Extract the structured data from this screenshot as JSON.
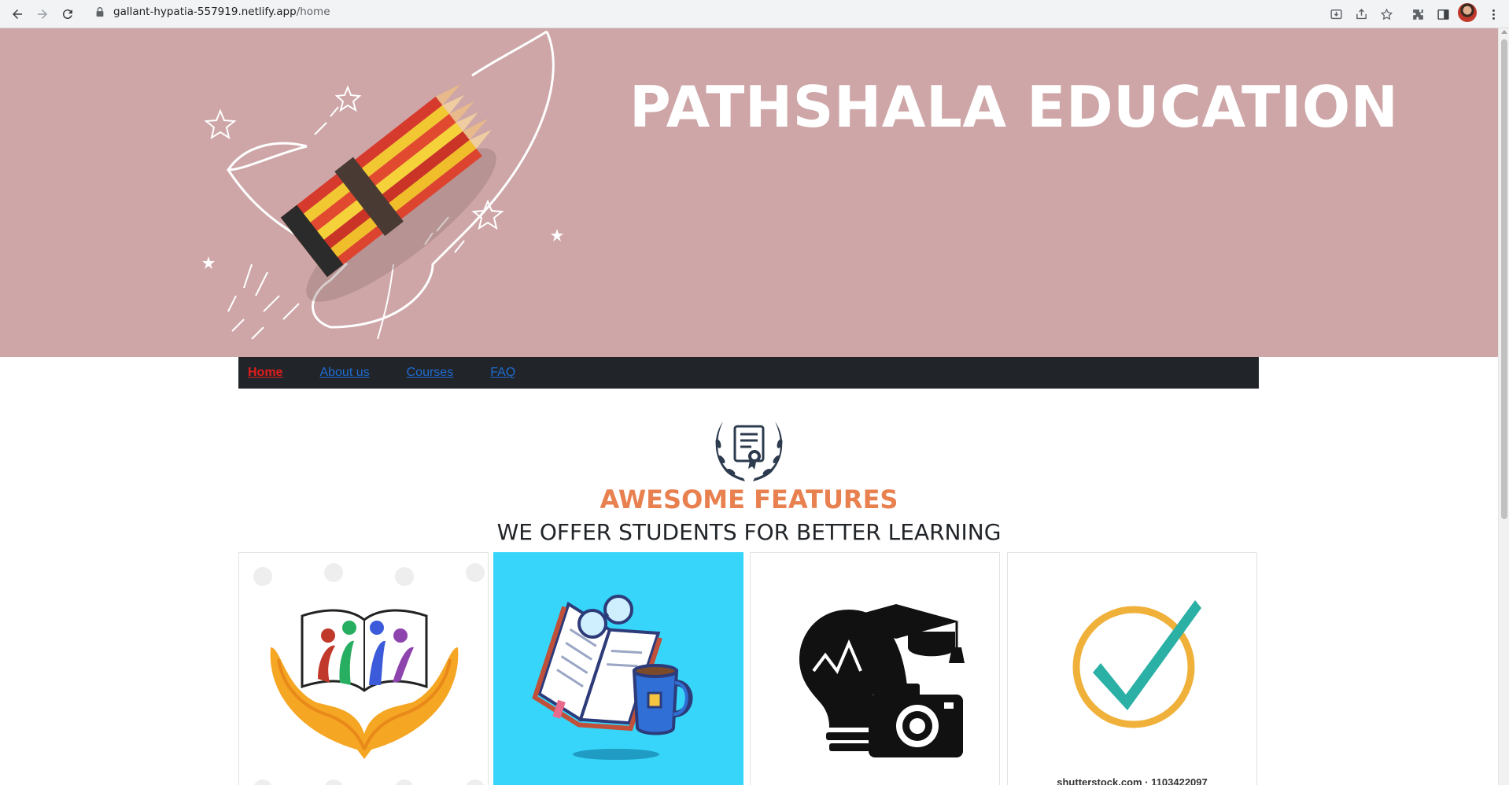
{
  "browser": {
    "url_host": "gallant-hypatia-557919.netlify.app",
    "url_path": "/home",
    "icons": [
      "back-icon",
      "forward-icon",
      "reload-icon",
      "lock-icon",
      "install-icon",
      "share-icon",
      "bookmark-star-icon",
      "extensions-icon",
      "side-panel-icon",
      "profile-avatar",
      "menu-kebab-icon"
    ]
  },
  "hero": {
    "title": "PATHSHALA EDUCATION",
    "background": "#cea6a7"
  },
  "nav": {
    "items": [
      {
        "label": "Home",
        "active": true
      },
      {
        "label": "About us",
        "active": false
      },
      {
        "label": "Courses",
        "active": false
      },
      {
        "label": "FAQ",
        "active": false
      }
    ]
  },
  "features": {
    "emblem_icon": "certificate-laurel-icon",
    "title": "AWESOME FEATURES",
    "subtitle": "WE OFFER STUDENTS FOR BETTER LEARNING",
    "title_color": "#e8804f"
  },
  "cards": [
    {
      "icon": "hands-book-people-icon",
      "caption": ""
    },
    {
      "icon": "book-glasses-mug-icon",
      "caption": "",
      "background": "#37d5f9"
    },
    {
      "icon": "bulb-graduation-camera-icon",
      "caption": ""
    },
    {
      "icon": "checkmark-circle-icon",
      "caption": "shutterstock.com · 1103422097"
    }
  ]
}
